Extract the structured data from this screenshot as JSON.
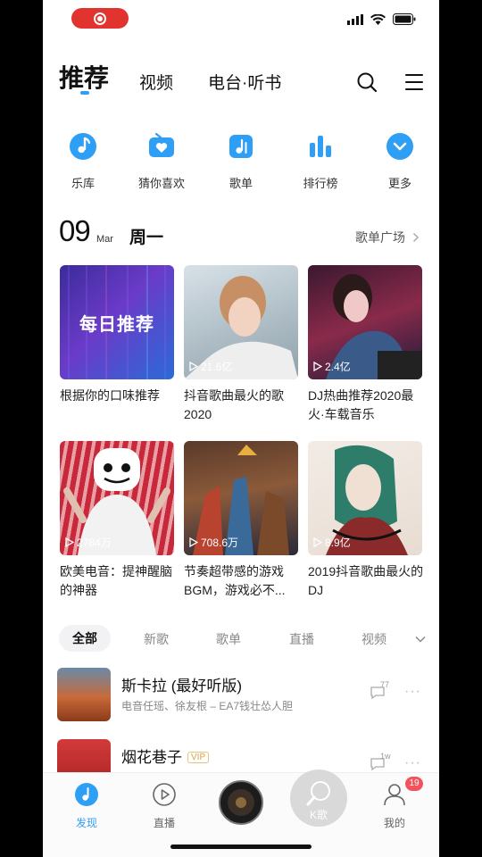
{
  "top_tabs": {
    "recommend": "推荐",
    "video": "视频",
    "radio": "电台·听书"
  },
  "accent": "#2f9ef5",
  "shortcuts": [
    {
      "label": "乐库",
      "icon": "music-note-icon"
    },
    {
      "label": "猜你喜欢",
      "icon": "radio-heart-icon"
    },
    {
      "label": "歌单",
      "icon": "playlist-icon"
    },
    {
      "label": "排行榜",
      "icon": "ranking-icon"
    },
    {
      "label": "更多",
      "icon": "chevron-down-icon"
    }
  ],
  "date": {
    "day": "09",
    "month": "Mar",
    "weekday": "周一",
    "more": "歌单广场"
  },
  "playlists": [
    {
      "cover_text": "每日推荐",
      "plays": "",
      "title": "根据你的口味推荐"
    },
    {
      "plays": "21.6亿",
      "title": "抖音歌曲最火的歌2020"
    },
    {
      "plays": "2.4亿",
      "title": "DJ热曲推荐2020最火·车载音乐"
    },
    {
      "plays": "2784万",
      "title": "欧美电音：提神醒脑的神器"
    },
    {
      "plays": "708.6万",
      "title": "节奏超带感的游戏BGM，游戏必不..."
    },
    {
      "plays": "8.9亿",
      "title": "2019抖音歌曲最火的DJ"
    }
  ],
  "categories": {
    "all": "全部",
    "new": "新歌",
    "playlist": "歌单",
    "live": "直播",
    "video": "视频"
  },
  "songs": [
    {
      "title": "斯卡拉 (最好听版)",
      "subtitle": "电音任瑶、徐友根 – EA7钱壮怂人胆",
      "comments": "77",
      "vip": ""
    },
    {
      "title": "烟花巷子",
      "subtitle": "",
      "comments": "1w",
      "vip": "VIP"
    }
  ],
  "bottom_nav": {
    "discover": "发现",
    "live": "直播",
    "kge": "K歌",
    "me": "我的",
    "badge": "19"
  }
}
